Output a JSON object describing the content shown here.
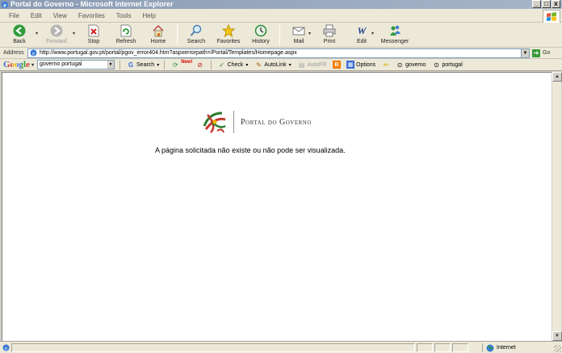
{
  "window": {
    "title": "Portal do Governo - Microsoft Internet Explorer",
    "controls": {
      "minimize": "_",
      "maximize": "□",
      "close": "x"
    }
  },
  "menu": [
    "File",
    "Edit",
    "View",
    "Favorites",
    "Tools",
    "Help"
  ],
  "toolbar": {
    "back": "Back",
    "forward": "Forward",
    "stop": "Stop",
    "refresh": "Refresh",
    "home": "Home",
    "search": "Search",
    "favorites": "Favorites",
    "history": "History",
    "mail": "Mail",
    "print": "Print",
    "edit": "Edit",
    "messenger": "Messenger"
  },
  "address": {
    "label": "Address",
    "url": "http://www.portugal.gov.pt/portal/pgov_error404.htm?aspxerrorpath=/Portal/Templates/Homepage.aspx",
    "go": "Go"
  },
  "google": {
    "logo": "Google",
    "query": "governo portugal",
    "search": "Search",
    "new_badge": "New!",
    "check": "Check",
    "autolink": "AutoLink",
    "autofill": "AutoFill",
    "options": "Options",
    "term1": "governo",
    "term2": "portugal"
  },
  "page": {
    "logo_text": "Portal do Governo",
    "error_message": "A página solicitada não existe ou não pode ser visualizada."
  },
  "status": {
    "zone": "Internet"
  },
  "colors": {
    "titlebar": "#8a9bb3",
    "chrome": "#ece9d8",
    "logo_red": "#c0392b",
    "logo_green": "#2e7d32"
  }
}
